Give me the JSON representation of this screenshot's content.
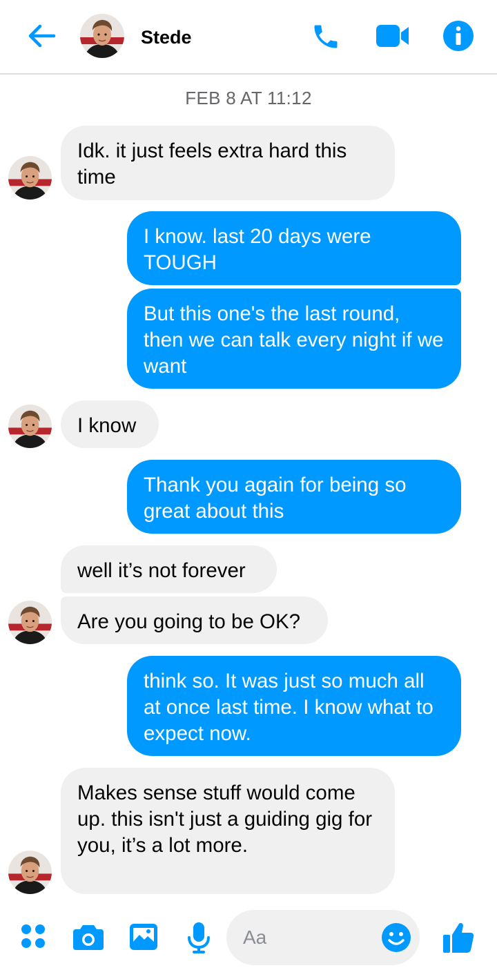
{
  "header": {
    "contact_name": "Stede"
  },
  "conversation": {
    "timestamp": "FEB 8 AT 11:12",
    "messages": [
      {
        "sender": "Stede",
        "text": "Idk. it just feels extra hard this time"
      },
      {
        "sender": "me",
        "text": "I know. last 20 days were TOUGH"
      },
      {
        "sender": "me",
        "text": "But this one's the last round, then we can talk every night if we want"
      },
      {
        "sender": "Stede",
        "text": "I know"
      },
      {
        "sender": "me",
        "text": "Thank you again for being so great about this"
      },
      {
        "sender": "Stede",
        "text": "well it’s not forever"
      },
      {
        "sender": "Stede",
        "text": "Are you going to be OK?"
      },
      {
        "sender": "me",
        "text": "think so. It was just so much all at once last time. I know what to expect now."
      },
      {
        "sender": "Stede",
        "text": "Makes sense stuff would come up. this isn't just a guiding gig for you, it’s a lot more."
      }
    ]
  },
  "composer": {
    "placeholder": "Aa"
  },
  "colors": {
    "accent": "#0099ff",
    "incoming_bubble": "#f0f0f0",
    "outgoing_bubble": "#0099ff"
  },
  "icons": [
    "back-arrow-icon",
    "phone-icon",
    "video-camera-icon",
    "info-icon",
    "apps-grid-icon",
    "camera-icon",
    "gallery-icon",
    "microphone-icon",
    "emoji-icon",
    "thumbs-up-icon"
  ]
}
